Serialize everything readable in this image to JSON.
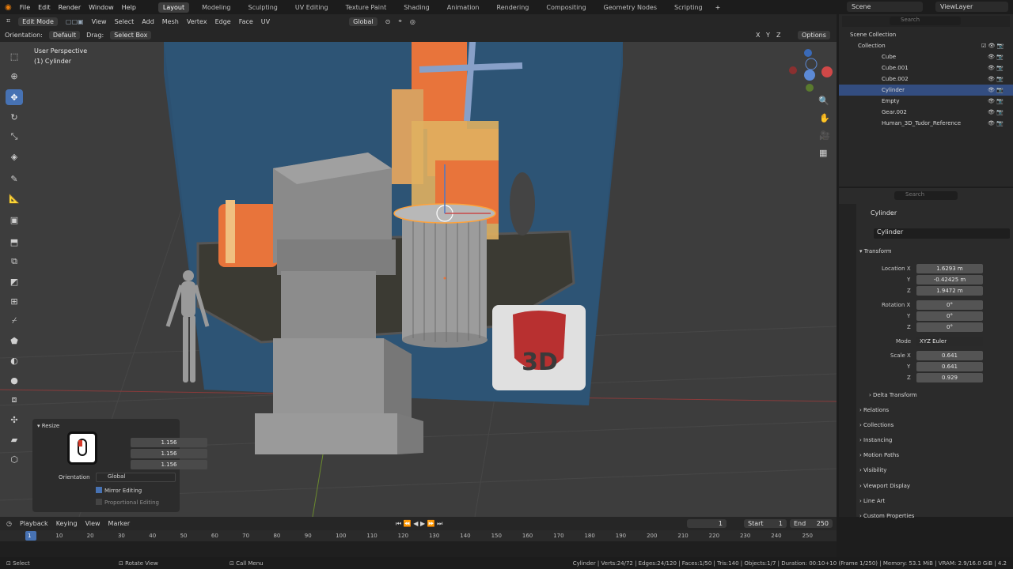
{
  "top_menu": {
    "items": [
      "File",
      "Edit",
      "Render",
      "Window",
      "Help"
    ]
  },
  "workspaces": {
    "tabs": [
      "Layout",
      "Modeling",
      "Sculpting",
      "UV Editing",
      "Texture Paint",
      "Shading",
      "Animation",
      "Rendering",
      "Compositing",
      "Geometry Nodes",
      "Scripting"
    ],
    "active": "Layout"
  },
  "scene": {
    "name": "Scene",
    "view_layer": "ViewLayer",
    "search_placeholder": "Search"
  },
  "viewport_header": {
    "mode": "Edit Mode",
    "menus": [
      "View",
      "Select",
      "Add",
      "Mesh",
      "Vertex",
      "Edge",
      "Face",
      "UV"
    ],
    "transform_orientation": "Global",
    "axes": [
      "X",
      "Y",
      "Z"
    ],
    "options": "Options"
  },
  "tool_settings": {
    "orientation_label": "Orientation:",
    "orientation_value": "Default",
    "drag_label": "Drag:",
    "drag_value": "Select Box"
  },
  "viewport": {
    "perspective": "User Perspective",
    "object": "(1) Cylinder"
  },
  "resize_panel": {
    "title": "Resize",
    "values": [
      "1.156",
      "1.156",
      "1.156"
    ],
    "orientation_label": "Orientation",
    "orientation_value": "Global",
    "mirror_editing": "Mirror Editing",
    "proportional_editing": "Proportional Editing"
  },
  "outliner": {
    "root": "Scene Collection",
    "collection": "Collection",
    "items": [
      "Cube",
      "Cube.001",
      "Cube.002",
      "Cylinder",
      "Empty",
      "Gear.002",
      "Human_3D_Tudor_Reference"
    ],
    "selected": "Cylinder"
  },
  "properties": {
    "search_placeholder": "Search",
    "object_name": "Cylinder",
    "data_name": "Cylinder",
    "transform_title": "Transform",
    "location_label": "Location X",
    "location": [
      "1.6293 m",
      "-0.42425 m",
      "1.9472 m"
    ],
    "rotation_label": "Rotation X",
    "rotation": [
      "0°",
      "0°",
      "0°"
    ],
    "mode_label": "Mode",
    "mode_value": "XYZ Euler",
    "scale_label": "Scale X",
    "scale": [
      "0.641",
      "0.641",
      "0.929"
    ],
    "axis_y": "Y",
    "axis_z": "Z",
    "sections": [
      "Delta Transform",
      "Relations",
      "Collections",
      "Instancing",
      "Motion Paths",
      "Visibility",
      "Viewport Display",
      "Line Art",
      "Custom Properties"
    ]
  },
  "timeline": {
    "menus": [
      "Playback",
      "Keying",
      "View",
      "Marker"
    ],
    "current_frame": "1",
    "start_label": "Start",
    "start": "1",
    "end_label": "End",
    "end": "250",
    "ticks": [
      "1",
      "10",
      "20",
      "30",
      "40",
      "50",
      "60",
      "70",
      "80",
      "90",
      "100",
      "110",
      "120",
      "130",
      "140",
      "150",
      "160",
      "170",
      "180",
      "190",
      "200",
      "210",
      "220",
      "230",
      "240",
      "250"
    ]
  },
  "status_bar": {
    "select": "Select",
    "rotate": "Rotate View",
    "call_menu": "Call Menu",
    "stats": "Cylinder | Verts:24/72 | Edges:24/120 | Faces:1/50 | Tris:140 | Objects:1/7 | Duration: 00:10+10 (Frame 1/250) | Memory: 53.1 MiB | VRAM: 2.9/16.0 GiB | 4.2"
  },
  "colors": {
    "accent": "#4772b3",
    "selection": "#334d80",
    "viewport": "#3d3d3d",
    "orange": "#e8743b",
    "backdrop": "#2c5070"
  }
}
